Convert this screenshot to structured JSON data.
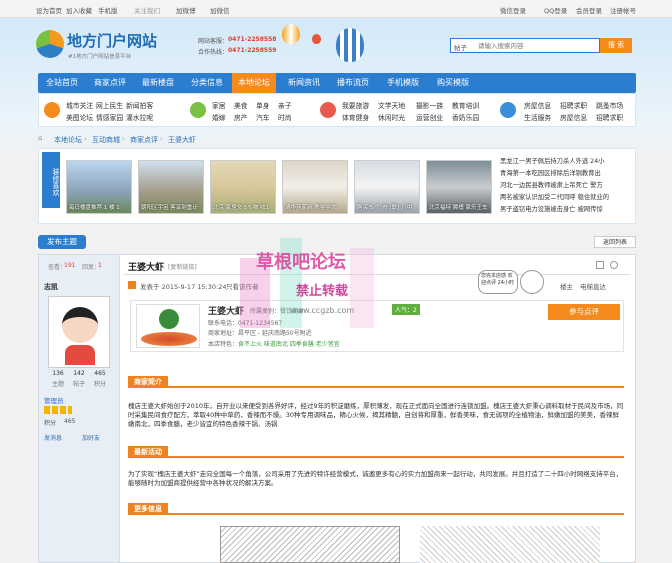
{
  "topbar": {
    "items": [
      "设为首页",
      "加入收藏",
      "手机版",
      "关注我们",
      "加微博",
      "加微信"
    ],
    "wechat": "微信登录",
    "qq": "QQ登录",
    "member": "会员登录",
    "register": "注册帐号"
  },
  "header": {
    "logo_title": "地方门户网站",
    "logo_sub": "#1地方门户网站信息平台",
    "hotline_label": "网站客服：",
    "hotline": "0471-2258558",
    "coop_label": "合作热线：",
    "coop": "0471-2258559",
    "search_type": "帖子",
    "search_placeholder": "请输入搜索内容",
    "search_button": "搜 索"
  },
  "nav": [
    "全站首页",
    "商家点评",
    "最新楼盘",
    "分类信息",
    "本地论坛",
    "新闻资讯",
    "播布流页",
    "手机模版",
    "购买模版"
  ],
  "categories": [
    [
      "城市关注",
      "网上民生",
      "新闻拍客",
      "美图论坛",
      "情感家园",
      "灌水拉呢"
    ],
    [
      "家居",
      "美食",
      "单身",
      "亲子",
      "婚嫁",
      "房产",
      "汽车",
      "时尚"
    ],
    [
      "我要旅游",
      "文学天地",
      "摄影一族",
      "教育培训",
      "体育健身",
      "休闲时光",
      "运营创业",
      "香奶乐园"
    ],
    [
      "房屋信息",
      "招聘求职",
      "跳蚤市场",
      "生活服务",
      "房屋信息",
      "招聘求职"
    ]
  ],
  "breadcrumb": [
    "本地论坛",
    "互动商城",
    "商家点评",
    "王婆大虾"
  ],
  "featured_label": "装修喜欢",
  "pictures": [
    "每日楼盘推荐 1 楼 1",
    "朝阳区宇宙 客享到重计",
    "北京 家居文 5%物 收1",
    "清华苑家新 教学中文",
    "购买 5 个 市 [联] 万中",
    "北京福特 翼搏 家乐王车"
  ],
  "news": [
    "黑龙江一男子佩后持刀杀人外逃 24小",
    "青海第一本吃园区排除后洋铜教育出",
    "河北一边民县教师被肃上吊死亡 警方",
    "两名被家认识加受二代同呼 稳住就业的",
    "男子盗窃电力设施被击身亡 被网传惊"
  ],
  "post_button": "发布主题",
  "back_button": "返回列表",
  "author": {
    "views_label": "查看：",
    "views": "191",
    "replies_label": "回复：",
    "replies": "1",
    "name": "志凯",
    "stat_values": [
      "136",
      "142",
      "465"
    ],
    "stat_labels": [
      "主题",
      "帖子",
      "积分"
    ],
    "rank": "管理员",
    "points_label": "积分",
    "points": "465",
    "send_msg": "发消息",
    "add_friend": "加好友"
  },
  "post": {
    "title": "王婆大虾",
    "copy_link": "[复制链接]",
    "post_time": "发表于 2015-9-17 15:30:24",
    "view_author": "只看该作者",
    "floor": "楼主",
    "sort": "电梯直达",
    "biz_name": "王婆大虾",
    "biz_type": "所属类别：餐饮美食",
    "biz_phone": "联系电话：0471-1234567",
    "biz_addr": "商家地址：昌平区 - 延庆南路50号附近",
    "features_label": "本店特色：",
    "features": "食不上火 味道南北 四季食膳 老少皆宜",
    "score": "人气：2",
    "comment_btn": "参与点评",
    "dialog": "您完本店感 欢迎点评 24小时"
  },
  "sections": {
    "intro": "商家简介",
    "intro_text": "槐店王婆大虾始创于2010年，自开业以来便受到各界好评，经过9年的积淀磨练，厚积薄发，现在正式面向全国进行连锁加盟。槐店王婆大虾秉心调料取材于民间及市场，同时采集民间食疗配方，萃取40种中草药，香辣而不燥。30种专用调味品，精心火候，揭其精髓，自创将和厚重，鲜香美味，食无弱项的全植物油，鲜嫩加盟的美美，香辣鲜嫩南北，四季食膳，老少皆宜的特色香辣干锅、汤锅",
    "activity": "最新活动",
    "activity_text": "为了实现“槐店王婆大虾”走向全国每一个角落，公司采用了先进的特许经营模式，诚邀更多有心的实力加盟商来一起行动，共同发展。并且打造了二十四小时网络支持平台，能够随时为加盟商提供经营中各种状况的解决方案。",
    "more": "更多信息"
  },
  "watermark": {
    "line1": "草根吧论坛",
    "line2": "禁止转载",
    "url": "www.ccgzb.com"
  }
}
